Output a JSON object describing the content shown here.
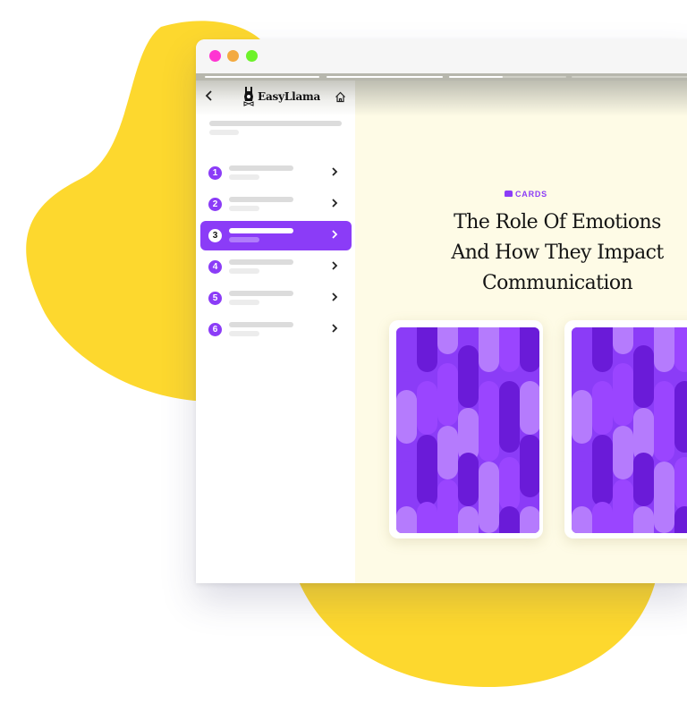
{
  "colors": {
    "accent": "#8b3cf7",
    "blob": "#fdd82e",
    "content_bg": "#fefbe6",
    "traffic_close": "#ff35d2",
    "traffic_minimize": "#f3aa40",
    "traffic_maximize": "#6df22a",
    "pattern": [
      "#8b3cf7",
      "#6a1bd8",
      "#b57bfd",
      "#9a45ff"
    ]
  },
  "window": {
    "traffic_lights": [
      "close",
      "minimize",
      "maximize"
    ],
    "course_progress": [
      1.0,
      1.0,
      0.46,
      0.0
    ]
  },
  "sidebar": {
    "back_icon": "chevron-left-icon",
    "logo_icon": "llama-icon",
    "logo_text": "EasyLlama",
    "home_icon": "home-icon",
    "lessons": [
      {
        "number": "1",
        "active": false
      },
      {
        "number": "2",
        "active": false
      },
      {
        "number": "3",
        "active": true
      },
      {
        "number": "4",
        "active": false
      },
      {
        "number": "5",
        "active": false
      },
      {
        "number": "6",
        "active": false
      }
    ]
  },
  "main": {
    "tag_icon": "cards-icon",
    "tag_label": "CARDS",
    "title_lines": [
      "The Role Of Emotions",
      "And How They Impact",
      "Communication"
    ],
    "cards": [
      {
        "name": "card-1"
      },
      {
        "name": "card-2"
      }
    ]
  }
}
